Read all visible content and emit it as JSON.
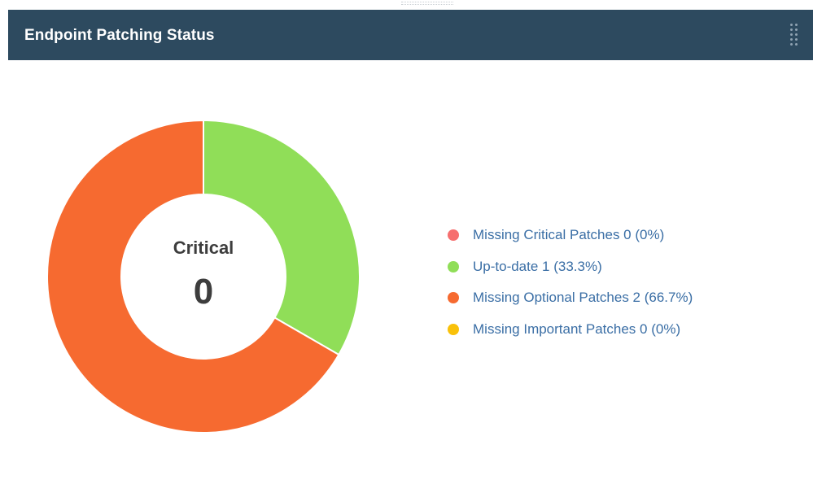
{
  "widget": {
    "title": "Endpoint Patching Status",
    "center_label": "Critical",
    "center_value": "0"
  },
  "colors": {
    "header_bg": "#2d4a5f",
    "missing_critical": "#f66f6f",
    "up_to_date": "#90de58",
    "missing_optional": "#f66a30",
    "missing_important": "#f9c10a",
    "legend_text": "#3a6ea5"
  },
  "icons": {
    "drag_handle": "drag-handle-icon"
  },
  "legend": [
    {
      "label": "Missing Critical Patches 0 (0%)",
      "color": "#f66f6f"
    },
    {
      "label": "Up-to-date 1 (33.3%)",
      "color": "#90de58"
    },
    {
      "label": "Missing Optional Patches 2 (66.7%)",
      "color": "#f66a30"
    },
    {
      "label": "Missing Important Patches 0 (0%)",
      "color": "#f9c10a"
    }
  ],
  "chart_data": {
    "type": "pie",
    "variant": "donut",
    "categories": [
      "Missing Critical Patches",
      "Up-to-date",
      "Missing Optional Patches",
      "Missing Important Patches"
    ],
    "values": [
      0,
      1,
      2,
      0
    ],
    "percentages": [
      0,
      33.3,
      66.7,
      0
    ],
    "colors": [
      "#f66f6f",
      "#90de58",
      "#f66a30",
      "#f9c10a"
    ],
    "legend_position": "right"
  }
}
